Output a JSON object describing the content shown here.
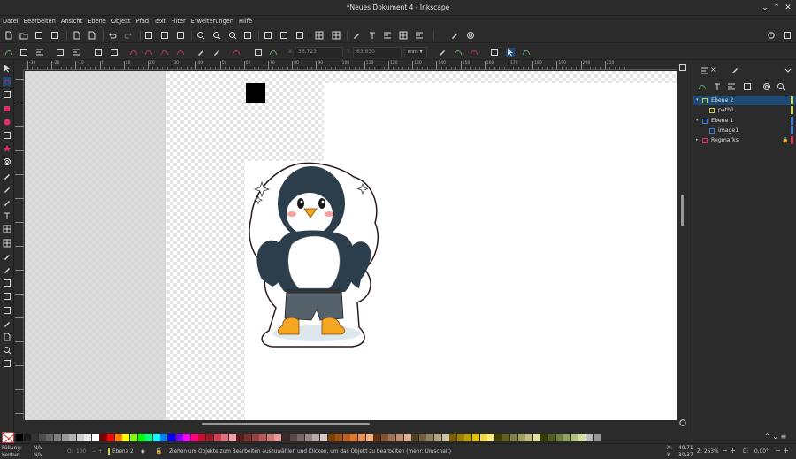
{
  "window": {
    "title": "*Neues Dokument 4 - Inkscape"
  },
  "menu": [
    "Datei",
    "Bearbeiten",
    "Ansicht",
    "Ebene",
    "Objekt",
    "Pfad",
    "Text",
    "Filter",
    "Erweiterungen",
    "Hilfe"
  ],
  "controls": {
    "x_label": "X:",
    "x_value": "36,723",
    "y_label": "Y:",
    "y_value": "63,630",
    "unit": "mm"
  },
  "ruler": {
    "top_ticks": [
      "-30",
      "-20",
      "-10",
      "0",
      "10",
      "20",
      "30",
      "40",
      "50",
      "60",
      "70",
      "80",
      "90",
      "100",
      "110",
      "120",
      "130",
      "140",
      "150",
      "160",
      "170",
      "180",
      "190",
      "200",
      "210"
    ]
  },
  "layers": [
    {
      "name": "Ebene 2",
      "indent": 0,
      "expanded": true,
      "selected": true,
      "color": "#c8d84a",
      "locked": false
    },
    {
      "name": "path1",
      "indent": 1,
      "selected": false,
      "color": "#c8d84a",
      "locked": false
    },
    {
      "name": "Ebene 1",
      "indent": 0,
      "expanded": true,
      "selected": false,
      "color": "#3c7de0",
      "locked": false
    },
    {
      "name": "image1",
      "indent": 1,
      "selected": false,
      "color": "#3c7de0",
      "locked": false
    },
    {
      "name": "Regmarks",
      "indent": 0,
      "expanded": false,
      "selected": false,
      "color": "#e0305a",
      "locked": true
    }
  ],
  "status": {
    "fill_label": "Füllung:",
    "fill_value": "N/V",
    "stroke_label": "Kontur:",
    "stroke_value": "N/V",
    "opacity_label": "O:",
    "opacity_value": "100",
    "layer": "Ebene 2",
    "message": "Ziehen um Objekte zum Bearbeiten auszuwählen und Klicken, um das Objekt zu bearbeiten (mehr: Umschalt)",
    "x_label": "X:",
    "x_value": "49,71",
    "y_label": "Y:",
    "y_value": "30,37",
    "zoom_label": "Z:",
    "zoom_value": "253%",
    "rot_label": "D:",
    "rot_value": "0,00°"
  },
  "colors": {
    "accent": "#1e4a74",
    "canvas": "#ffffff",
    "checker": "#d0d0d0"
  }
}
